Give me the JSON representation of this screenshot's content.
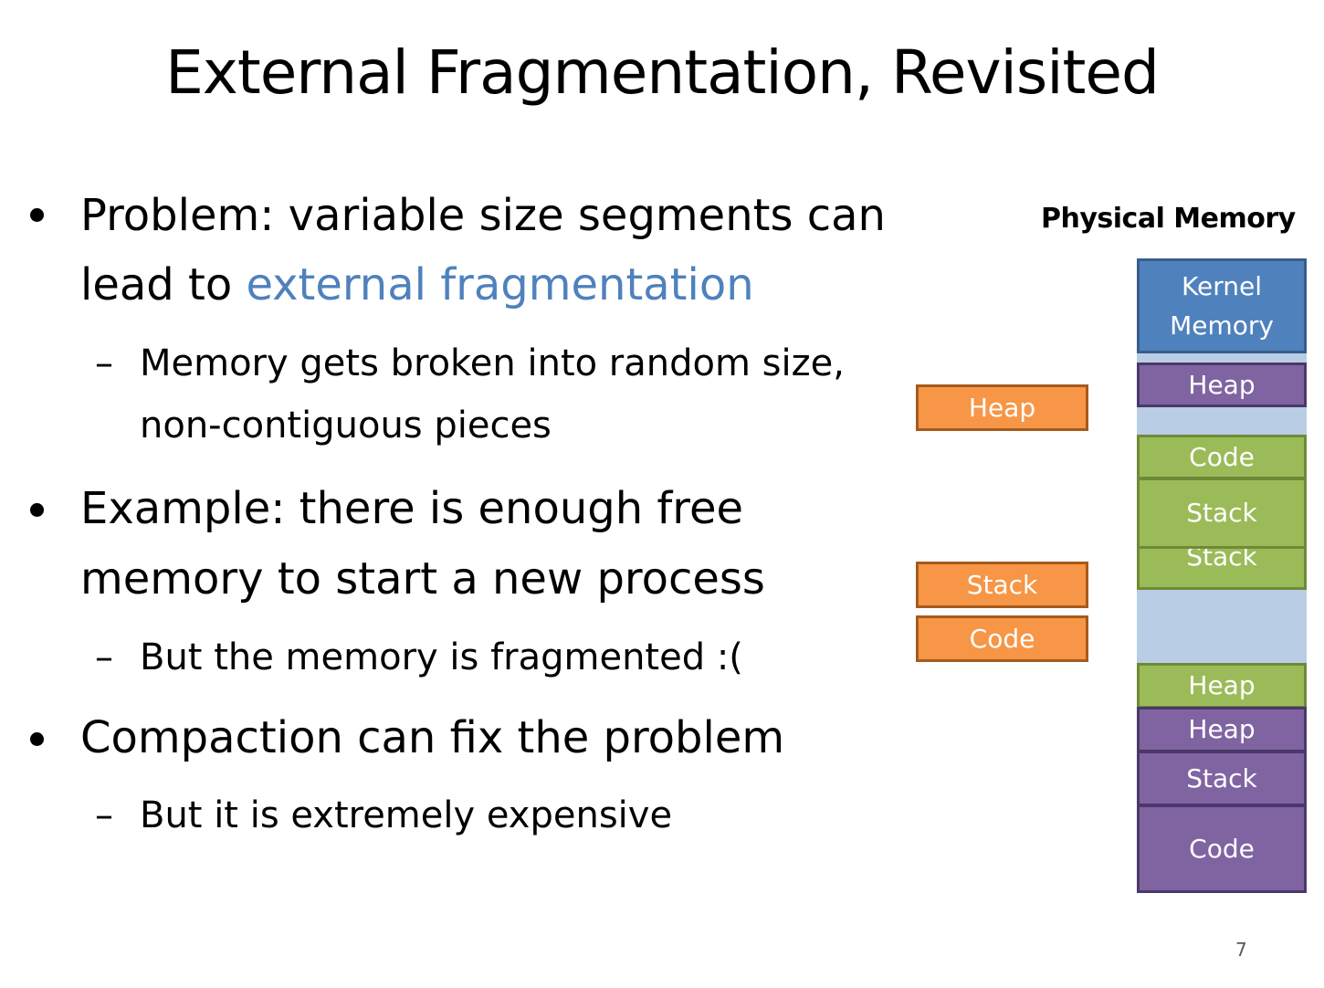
{
  "title": "External Fragmentation, Revisited",
  "bullets": [
    {
      "lines": [
        "Problem: variable size segments can",
        "lead to "
      ],
      "highlight": "external fragmentation",
      "sub": {
        "lines": [
          "Memory gets broken into random size,",
          "non-contiguous pieces"
        ]
      }
    },
    {
      "lines": [
        "Example: there is enough free",
        "memory to start a new process"
      ],
      "sub": {
        "lines": [
          "But the memory is fragmented :("
        ]
      }
    },
    {
      "lines": [
        "Compaction can fix the problem"
      ],
      "sub": {
        "lines": [
          "But it is extremely expensive"
        ]
      }
    }
  ],
  "diagram": {
    "title": "Physical Memory",
    "memory_blocks": [
      {
        "label": "Kernel\nMemory",
        "color": "#4f81bd"
      },
      {
        "label": "Heap",
        "color": "#8064a2"
      },
      {
        "label": "Code",
        "color": "#9bbb59"
      },
      {
        "label": "Stack",
        "color": "#9bbb59"
      },
      {
        "label": "Stack",
        "color": "#9bbb59"
      },
      {
        "label": "Heap",
        "color": "#9bbb59"
      },
      {
        "label": "Heap",
        "color": "#8064a2"
      },
      {
        "label": "Stack",
        "color": "#8064a2"
      },
      {
        "label": "Code",
        "color": "#8064a2"
      }
    ],
    "free_color": "#b9cde5",
    "new_process_blocks": [
      {
        "label": "Heap",
        "color": "#f79646"
      },
      {
        "label": "Stack",
        "color": "#f79646"
      },
      {
        "label": "Code",
        "color": "#f79646"
      }
    ]
  },
  "page_number": "7"
}
